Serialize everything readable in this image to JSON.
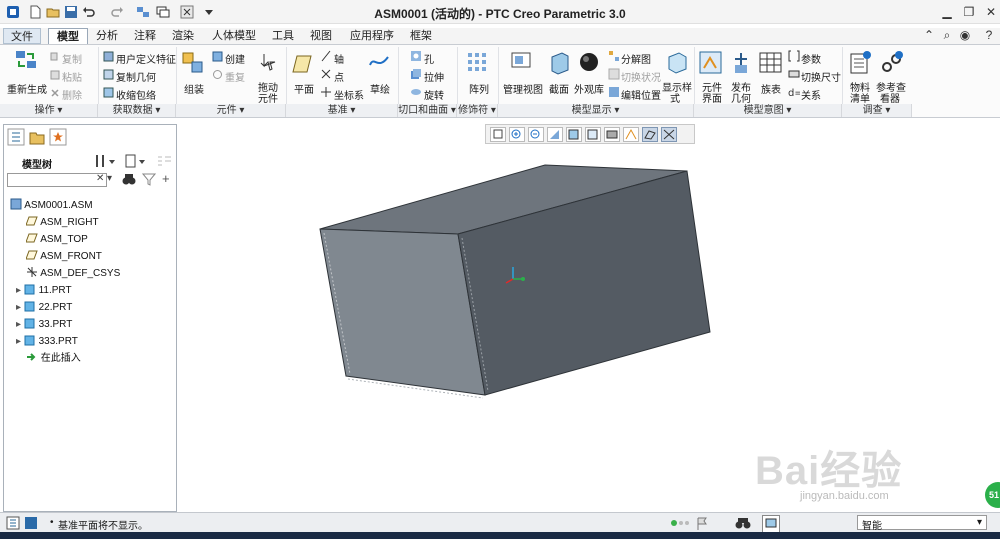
{
  "window": {
    "title": "ASM0001 (活动的) - PTC Creo Parametric 3.0"
  },
  "tabs": [
    {
      "label": "文件"
    },
    {
      "label": "模型"
    },
    {
      "label": "分析"
    },
    {
      "label": "注释"
    },
    {
      "label": "渲染"
    },
    {
      "label": "人体模型"
    },
    {
      "label": "工具"
    },
    {
      "label": "视图"
    },
    {
      "label": "应用程序"
    },
    {
      "label": "框架"
    }
  ],
  "ribbon": {
    "regenerate": "重新生成",
    "copy": "复制",
    "paste": "粘贴",
    "delete": "删除",
    "udf": "用户定义特征",
    "copy_geom": "复制几何",
    "shrinkwrap": "收缩包络",
    "assemble": "组装",
    "create": "创建",
    "repeat": "重复",
    "drag_line1": "拖动",
    "drag_line2": "元件",
    "plane": "平面",
    "axis": "轴",
    "point": "点",
    "csys": "坐标系",
    "sketch": "草绘",
    "hole": "孔",
    "extrude": "拉伸",
    "revolve": "旋转",
    "pattern": "阵列",
    "manage_views": "管理视图",
    "section": "截面",
    "appearance": "外观库",
    "explode": "分解图",
    "toggle_status": "切换状况",
    "edit_position": "编辑位置",
    "display_style_l1": "显示样",
    "display_style_l2": "式",
    "comp_interface_l1": "元件",
    "comp_interface_l2": "界面",
    "publish_geom_l1": "发布",
    "publish_geom_l2": "几何",
    "table": "族表",
    "params": "参数",
    "switch_dims": "切换尺寸",
    "relations": "关系",
    "bom_l1": "物料",
    "bom_l2": "清单",
    "ref_viewer_l1": "参考查",
    "ref_viewer_l2": "看器",
    "groups": [
      "操作",
      "获取数据",
      "元件",
      "基准",
      "切口和曲面",
      "修饰符",
      "模型显示",
      "模型意图",
      "调查"
    ]
  },
  "tree": {
    "label": "模型树",
    "items": [
      {
        "label": "ASM0001.ASM",
        "icon": "assembly-icon"
      },
      {
        "label": "ASM_RIGHT",
        "icon": "datum-plane-icon"
      },
      {
        "label": "ASM_TOP",
        "icon": "datum-plane-icon"
      },
      {
        "label": "ASM_FRONT",
        "icon": "datum-plane-icon"
      },
      {
        "label": "ASM_DEF_CSYS",
        "icon": "csys-icon"
      },
      {
        "label": "11.PRT",
        "icon": "part-icon"
      },
      {
        "label": "22.PRT",
        "icon": "part-icon"
      },
      {
        "label": "33.PRT",
        "icon": "part-icon"
      },
      {
        "label": "333.PRT",
        "icon": "part-icon"
      },
      {
        "label": "在此插入",
        "icon": "insert-here-icon"
      }
    ]
  },
  "status": {
    "message": "基准平面将不显示。",
    "filter": "智能"
  },
  "watermark": {
    "text": "Bai经验",
    "url": "jingyan.baidu.com"
  },
  "colors": {
    "model_top": "#6e757d",
    "model_left": "#808890",
    "model_right": "#545b63",
    "accent_blue": "#1f6fc5"
  }
}
